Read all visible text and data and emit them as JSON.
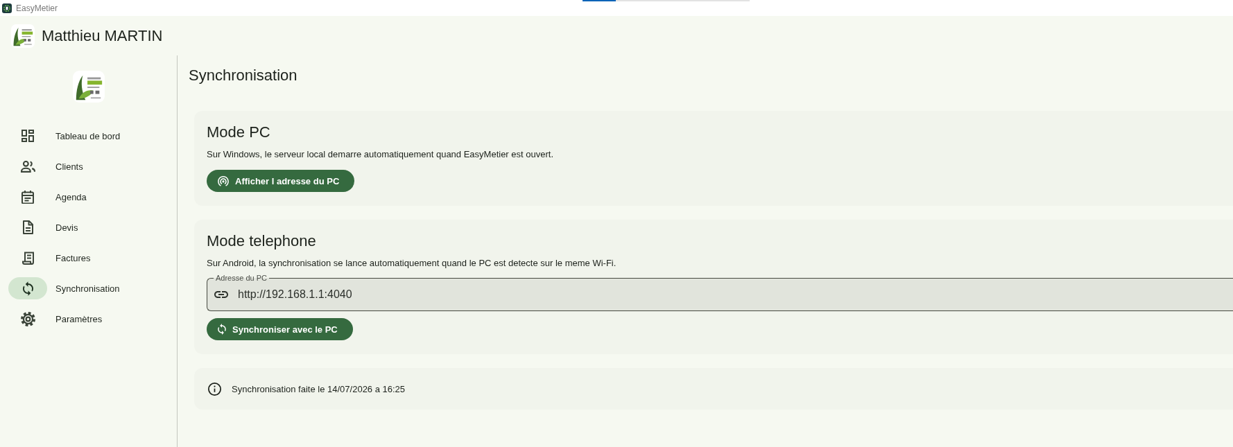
{
  "window": {
    "title": "EasyMetier",
    "loading_bar": {
      "level": 0.2
    }
  },
  "header": {
    "user_name": "Matthieu MARTIN"
  },
  "sidebar": {
    "items": [
      {
        "label": "Tableau de bord",
        "selected": false
      },
      {
        "label": "Clients",
        "selected": false
      },
      {
        "label": "Agenda",
        "selected": false
      },
      {
        "label": "Devis",
        "selected": false
      },
      {
        "label": "Factures",
        "selected": false
      },
      {
        "label": "Synchronisation",
        "selected": true
      },
      {
        "label": "Paramètres",
        "selected": false
      }
    ]
  },
  "page": {
    "title": "Synchronisation"
  },
  "sections": [
    {
      "kind": "mode",
      "title": "Mode PC",
      "description": "Sur Windows, le serveur local demarre automatiquement quand EasyMetier est ouvert.",
      "button": {
        "label": "Afficher l adresse du PC"
      }
    },
    {
      "kind": "mode",
      "title": "Mode telephone",
      "description": "Sur Android, la synchronisation se lance automatiquement quand le PC est detecte sur le meme Wi-Fi.",
      "field": {
        "label": "Adresse du PC",
        "value": "http://192.168.1.1:4040"
      },
      "button": {
        "label": "Synchroniser avec le PC"
      }
    },
    {
      "kind": "notice",
      "text": "Synchronisation faite le 14/07/2026 a 16:25"
    }
  ]
}
